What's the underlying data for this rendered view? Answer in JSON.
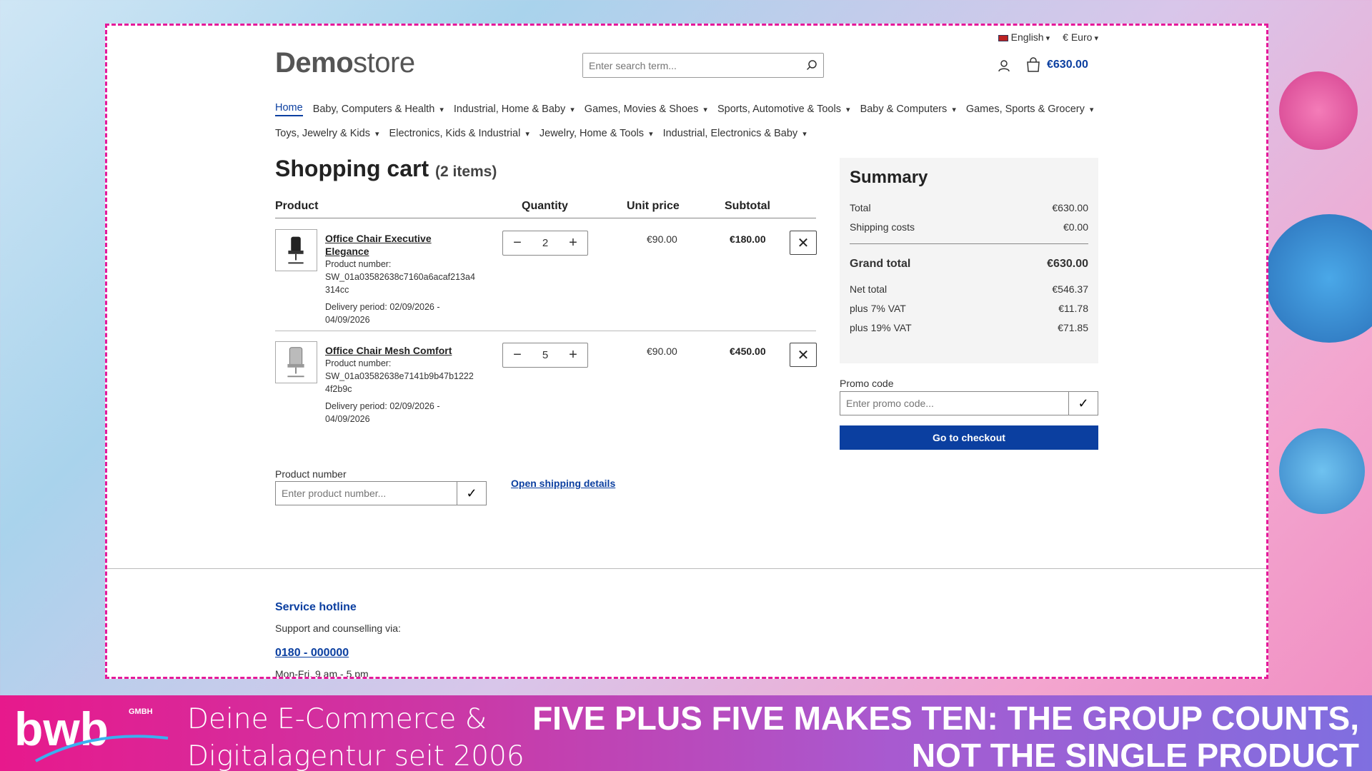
{
  "topbar": {
    "language": "English",
    "currency": "€ Euro"
  },
  "header": {
    "logo_bold": "Demo",
    "logo_light": "store",
    "search_placeholder": "Enter search term...",
    "cart_total": "€630.00"
  },
  "nav": {
    "row1": [
      "Home",
      "Baby, Computers & Health",
      "Industrial, Home & Baby",
      "Games, Movies & Shoes",
      "Sports, Automotive & Tools",
      "Baby & Computers",
      "Games, Sports & Grocery"
    ],
    "row2": [
      "Toys, Jewelry & Kids",
      "Electronics, Kids & Industrial",
      "Jewelry, Home & Tools",
      "Industrial, Electronics & Baby"
    ]
  },
  "cart": {
    "title": "Shopping cart",
    "count": "(2 items)",
    "columns": {
      "product": "Product",
      "quantity": "Quantity",
      "unit_price": "Unit price",
      "subtotal": "Subtotal"
    },
    "items": [
      {
        "name": "Office Chair Executive Elegance",
        "number_label": "Product number:",
        "number": "SW_01a03582638c7160a6acaf213a4314cc",
        "delivery": "Delivery period: 02/09/2026 - 04/09/2026",
        "qty": "2",
        "unit_price": "€90.00",
        "subtotal": "€180.00"
      },
      {
        "name": "Office Chair Mesh Comfort",
        "number_label": "Product number:",
        "number": "SW_01a03582638e7141b9b47b12224f2b9c",
        "delivery": "Delivery period: 02/09/2026 - 04/09/2026",
        "qty": "5",
        "unit_price": "€90.00",
        "subtotal": "€450.00"
      }
    ],
    "product_number_label": "Product number",
    "product_number_placeholder": "Enter product number...",
    "shipping_link": "Open shipping details"
  },
  "summary": {
    "title": "Summary",
    "total_label": "Total",
    "total": "€630.00",
    "shipping_label": "Shipping costs",
    "shipping": "€0.00",
    "grand_label": "Grand total",
    "grand": "€630.00",
    "net_label": "Net total",
    "net": "€546.37",
    "vat7_label": "plus 7% VAT",
    "vat7": "€11.78",
    "vat19_label": "plus 19% VAT",
    "vat19": "€71.85",
    "promo_label": "Promo code",
    "promo_placeholder": "Enter promo code...",
    "checkout": "Go to checkout"
  },
  "footer": {
    "heading": "Service hotline",
    "support": "Support and counselling via:",
    "phone": "0180 - 000000",
    "hours": "Mon-Fri, 9 am - 5 pm"
  },
  "banner": {
    "logo_text": "bwb",
    "logo_sub": "GMBH",
    "tagline_line1": "Deine E-Commerce &",
    "tagline_line2": "Digitalagentur seit 2006",
    "headline_line1": "FIVE PLUS FIVE MAKES TEN: THE GROUP COUNTS,",
    "headline_line2": "NOT THE SINGLE PRODUCT"
  },
  "colors": {
    "accent": "#0b3fa0",
    "frame": "#e5199a",
    "banner_start": "#e7198c",
    "banner_end": "#7f6fe0"
  }
}
